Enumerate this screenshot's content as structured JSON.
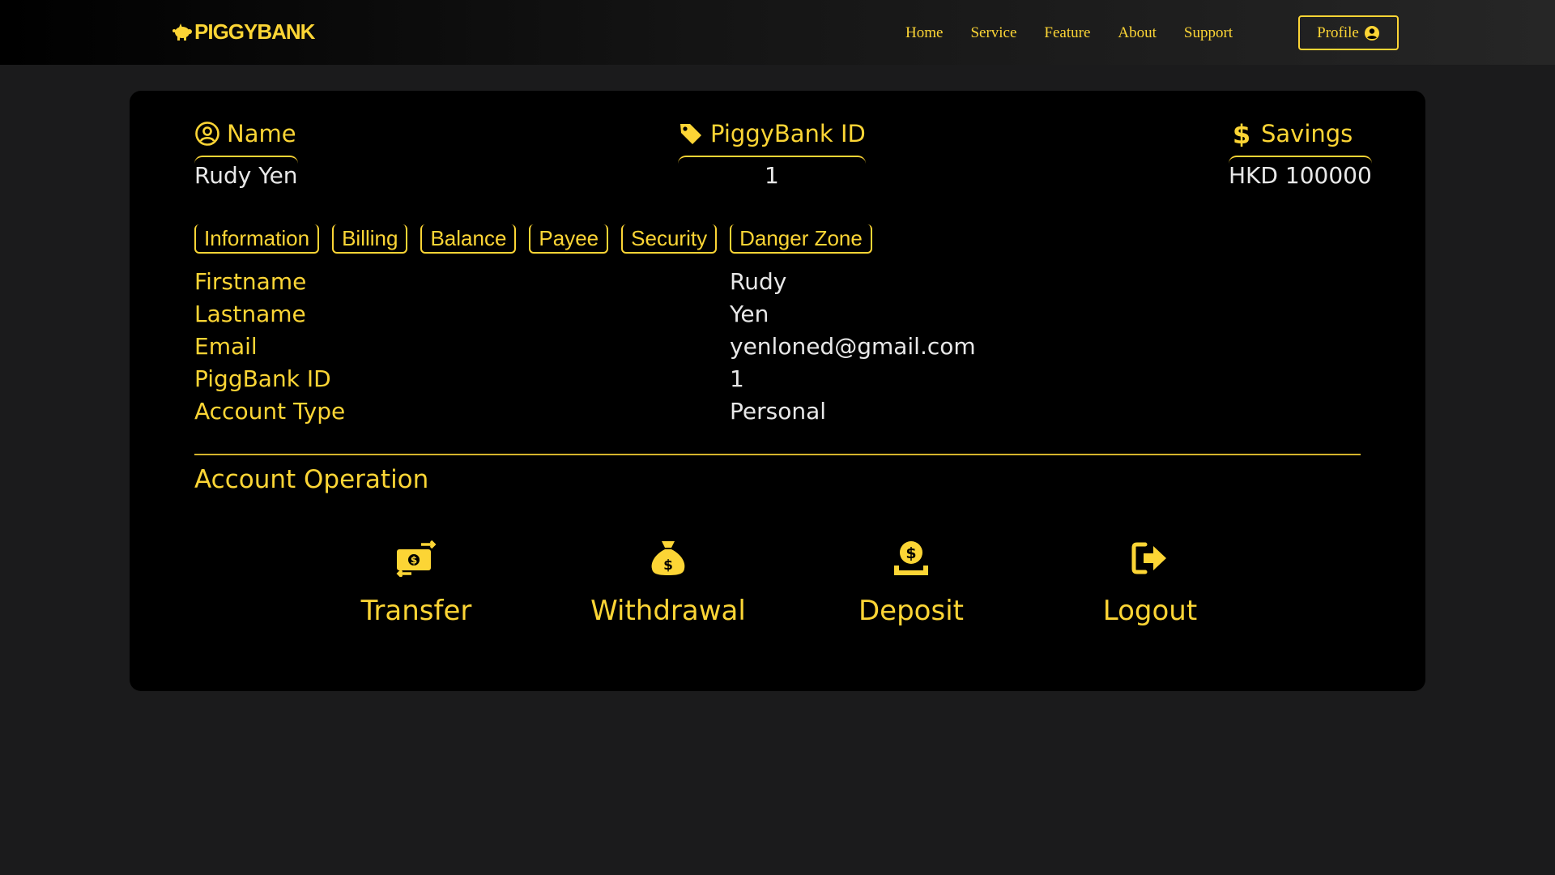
{
  "nav": {
    "brand": "PIGGYBANK",
    "links": [
      "Home",
      "Service",
      "Feature",
      "About",
      "Support"
    ],
    "profile_label": "Profile"
  },
  "summary": {
    "name_label": "Name",
    "name_value": "Rudy Yen",
    "id_label": "PiggyBank ID",
    "id_value": "1",
    "savings_label": "Savings",
    "savings_value": "HKD 100000"
  },
  "tabs": [
    "Information",
    "Billing",
    "Balance",
    "Payee",
    "Security",
    "Danger Zone"
  ],
  "info": [
    {
      "key": "Firstname",
      "value": "Rudy"
    },
    {
      "key": "Lastname",
      "value": "Yen"
    },
    {
      "key": "Email",
      "value": "yenloned@gmail.com"
    },
    {
      "key": "PiggBank ID",
      "value": "1"
    },
    {
      "key": "Account Type",
      "value": "Personal"
    }
  ],
  "operations": {
    "title": "Account Operation",
    "items": [
      {
        "label": "Transfer",
        "icon": "money-transfer-icon"
      },
      {
        "label": "Withdrawal",
        "icon": "money-bag-icon"
      },
      {
        "label": "Deposit",
        "icon": "deposit-coin-icon"
      },
      {
        "label": "Logout",
        "icon": "logout-icon"
      }
    ]
  },
  "colors": {
    "accent": "#fcd535",
    "page_bg": "#1b1b1c",
    "card_bg": "#000000",
    "value_text": "#e8e8e8"
  }
}
